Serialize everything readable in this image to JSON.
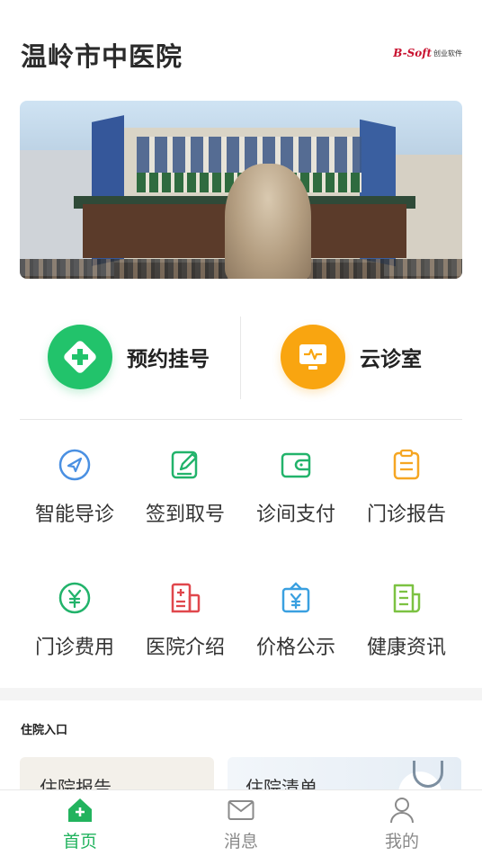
{
  "header": {
    "title": "温岭市中医院",
    "brand_mark": "B-Soft",
    "brand_text": "创业软件"
  },
  "quick_actions": [
    {
      "label": "预约挂号",
      "icon": "medical-cross-icon",
      "color": "#22c36b"
    },
    {
      "label": "云诊室",
      "icon": "monitor-pulse-icon",
      "color": "#f9a510"
    }
  ],
  "services": [
    {
      "label": "智能导诊",
      "icon": "compass-icon",
      "color": "#4a90e2"
    },
    {
      "label": "签到取号",
      "icon": "edit-icon",
      "color": "#22b36b"
    },
    {
      "label": "诊间支付",
      "icon": "wallet-icon",
      "color": "#22b36b"
    },
    {
      "label": "门诊报告",
      "icon": "clipboard-icon",
      "color": "#f5a623"
    },
    {
      "label": "门诊费用",
      "icon": "yuan-coin-icon",
      "color": "#22b36b"
    },
    {
      "label": "医院介绍",
      "icon": "hospital-doc-icon",
      "color": "#e0474c"
    },
    {
      "label": "价格公示",
      "icon": "price-tag-icon",
      "color": "#3aa0e0"
    },
    {
      "label": "健康资讯",
      "icon": "news-icon",
      "color": "#7cc242"
    }
  ],
  "inpatient": {
    "section_title": "住院入口",
    "cards": [
      {
        "title": "住院报告"
      },
      {
        "title": "住院清单"
      }
    ]
  },
  "tabbar": [
    {
      "label": "首页",
      "icon": "home-icon",
      "active": true
    },
    {
      "label": "消息",
      "icon": "mail-icon",
      "active": false
    },
    {
      "label": "我的",
      "icon": "user-icon",
      "active": false
    }
  ],
  "colors": {
    "accent": "#22b35e",
    "tab_inactive": "#8a8a8a"
  }
}
